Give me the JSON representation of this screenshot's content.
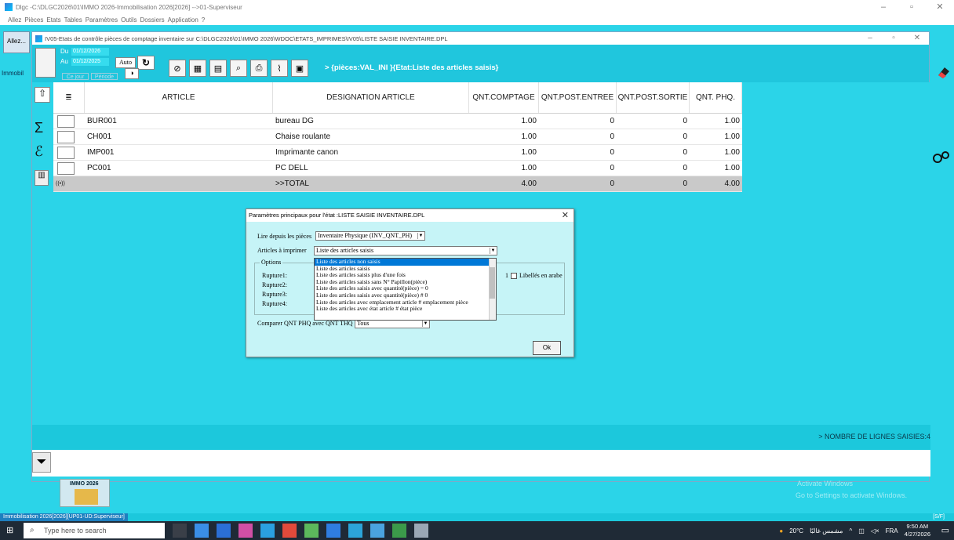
{
  "app": {
    "title": "Dlgc -C:\\DLGC2026\\01\\IMMO 2026-Immobilisation 2026[2026] -->01-Superviseur",
    "menu": [
      "Allez",
      "Pièces",
      "Etats",
      "Tables",
      "Paramètres",
      "Outils",
      "Dossiers",
      "Application",
      "?"
    ],
    "allez_label": "Allez...",
    "side_label": "Immobil"
  },
  "child": {
    "title": "IV05-Etats de contrôle pièces de comptage inventaire sur C:\\DLGC2026\\01\\IMMO 2026\\WDOC\\ETATS_IMPRIMES\\IV05\\LISTE SAISIE INVENTAIRE.DPL",
    "date_du_label": "Du",
    "date_du": "01/12/2026",
    "date_au_label": "Au",
    "date_au": "01/12/2025",
    "auto_label": "Auto",
    "ce_jour_label": "Ce jour",
    "periode_label": "Période",
    "status_text": "> {pièces:VAL_INI  }{Etat:Liste des articles saisis}"
  },
  "grid": {
    "columns": [
      "ARTICLE",
      "DESIGNATION ARTICLE",
      "QNT.COMPTAGE",
      "QNT.POST.ENTREE",
      "QNT.POST.SORTIE",
      "QNT. PHQ."
    ],
    "rows": [
      {
        "article": "BUR001",
        "designation": "bureau DG",
        "comptage": "1.00",
        "entree": "0",
        "sortie": "0",
        "phq": "1.00"
      },
      {
        "article": "CH001",
        "designation": "Chaise roulante",
        "comptage": "1.00",
        "entree": "0",
        "sortie": "0",
        "phq": "1.00"
      },
      {
        "article": "IMP001",
        "designation": "Imprimante canon",
        "comptage": "1.00",
        "entree": "0",
        "sortie": "0",
        "phq": "1.00"
      },
      {
        "article": "PC001",
        "designation": "PC DELL",
        "comptage": "1.00",
        "entree": "0",
        "sortie": "0",
        "phq": "1.00"
      }
    ],
    "total": {
      "marker": "((•))",
      "designation": ">>TOTAL",
      "comptage": "4.00",
      "entree": "0",
      "sortie": "0",
      "phq": "4.00"
    },
    "lines_count_text": "> NOMBRE DE LIGNES SAISIES:4"
  },
  "dialog": {
    "title": "Paramètres principaux pour l'état :LISTE SAISIE INVENTAIRE.DPL",
    "lire_label": "Lire depuis les pièces",
    "lire_value": "Inventaire Physique (INV_QNT_PH)",
    "articles_label": "Articles à imprimer",
    "articles_value": "Liste des articles saisis",
    "options_label": "Options",
    "ruptures": [
      "Rupture1:",
      "Rupture2:",
      "Rupture3:",
      "Rupture4:"
    ],
    "rupture_suffix": "1",
    "libelles_arabe_label": "Libellés en arabe",
    "dropdown_items": [
      "Liste des articles non saisis",
      "Liste des articles saisis",
      "Liste des articles saisis plus d'une fois",
      "Liste des articles saisis sans N° Papillon(pièce)",
      "Liste des articles saisis avec quantité(pièce) = 0",
      "Liste des articles saisis avec quantité(pièce) # 0",
      "Liste des articles avec emplacement article # emplacement pièce",
      "Liste des articles avec état article # état pièce"
    ],
    "comparer_label": "Comparer QNT PHQ avec QNT THQ",
    "comparer_value": "Tous",
    "ok_label": "Ok"
  },
  "footer": {
    "immo_label": "IMMO 2026",
    "watermark_title": "Activate Windows",
    "watermark_sub": "Go to Settings to activate Windows.",
    "status_left": "Immobilisation 2026[2026][UP01-UD:Superviseur]",
    "status_right": "[S/F]"
  },
  "taskbar": {
    "search_placeholder": "Type here to search",
    "weather": "20°C",
    "weather_text": "مشمس غالبًا",
    "lang": "FRA",
    "time": "9:50 AM",
    "date": "4/27/2026"
  }
}
